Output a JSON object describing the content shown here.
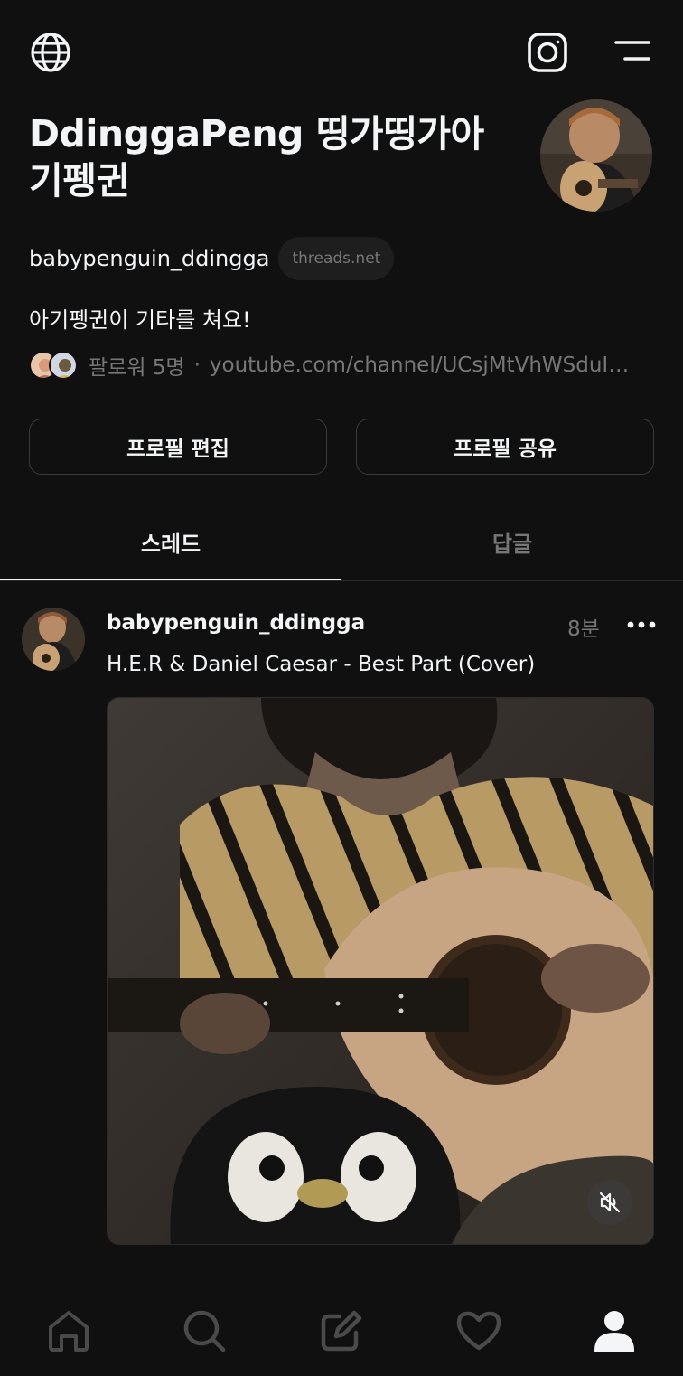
{
  "header": {
    "globe_icon": "globe-icon",
    "instagram_icon": "instagram-icon",
    "menu_icon": "menu-icon"
  },
  "profile": {
    "display_name": "DdinggaPeng 띵가띵가아기펭귄",
    "username": "babypenguin_ddingga",
    "domain_chip": "threads.net",
    "bio": "아기펭귄이 기타를 쳐요!",
    "followers": "팔로워 5명",
    "separator": "·",
    "link": "youtube.com/channel/UCsjMtVhWSduIR…"
  },
  "actions": {
    "edit_profile": "프로필 편집",
    "share_profile": "프로필 공유"
  },
  "tabs": [
    {
      "label": "스레드",
      "active": true
    },
    {
      "label": "답글",
      "active": false
    }
  ],
  "post": {
    "username": "babypenguin_ddingga",
    "time": "8분",
    "text": "H.E.R & Daniel Caesar - Best Part (Cover)",
    "more_icon": "more-icon",
    "mute_icon": "mute-icon"
  },
  "bottom_nav": [
    {
      "name": "home",
      "icon": "home-icon"
    },
    {
      "name": "search",
      "icon": "search-icon"
    },
    {
      "name": "compose",
      "icon": "compose-icon"
    },
    {
      "name": "activity",
      "icon": "heart-icon"
    },
    {
      "name": "profile",
      "icon": "profile-icon",
      "active": true
    }
  ],
  "colors": {
    "background": "#101010",
    "text": "#f3f5f7",
    "muted": "#777777",
    "border": "#3a3a3a"
  }
}
